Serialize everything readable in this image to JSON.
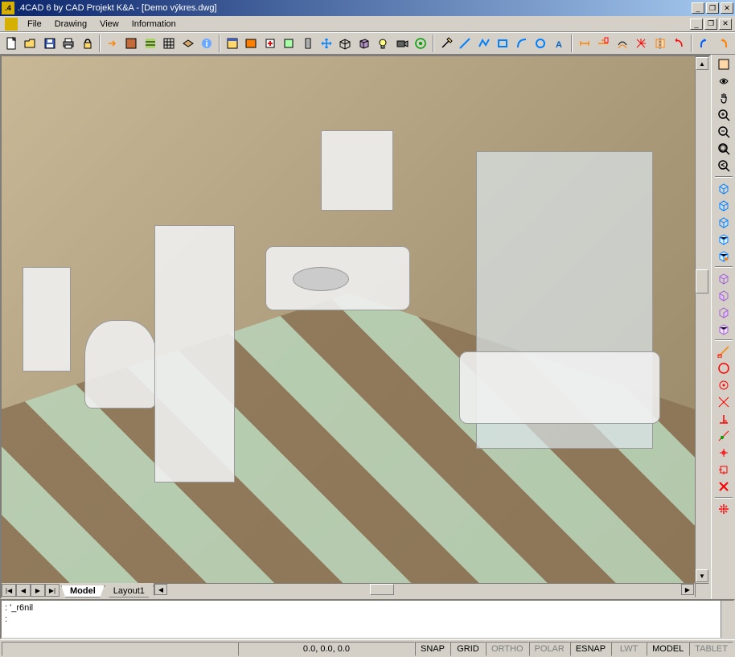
{
  "titlebar": {
    "app_icon_text": ".4",
    "title": ".4CAD 6 by CAD Projekt K&A - [Demo výkres.dwg]"
  },
  "menubar": {
    "file": "File",
    "drawing": "Drawing",
    "view": "View",
    "information": "Information"
  },
  "tabs": {
    "model": "Model",
    "layout1": "Layout1"
  },
  "command": {
    "line1": ": '_r6nil",
    "line2": ":"
  },
  "statusbar": {
    "coords": "0.0, 0.0, 0.0",
    "snap": "SNAP",
    "grid": "GRID",
    "ortho": "ORTHO",
    "polar": "POLAR",
    "esnap": "ESNAP",
    "lwt": "LWT",
    "model": "MODEL",
    "tablet": "TABLET"
  },
  "icons": {
    "new": "new",
    "open": "open",
    "save": "save",
    "print": "print",
    "lock": "lock",
    "info": "info"
  }
}
